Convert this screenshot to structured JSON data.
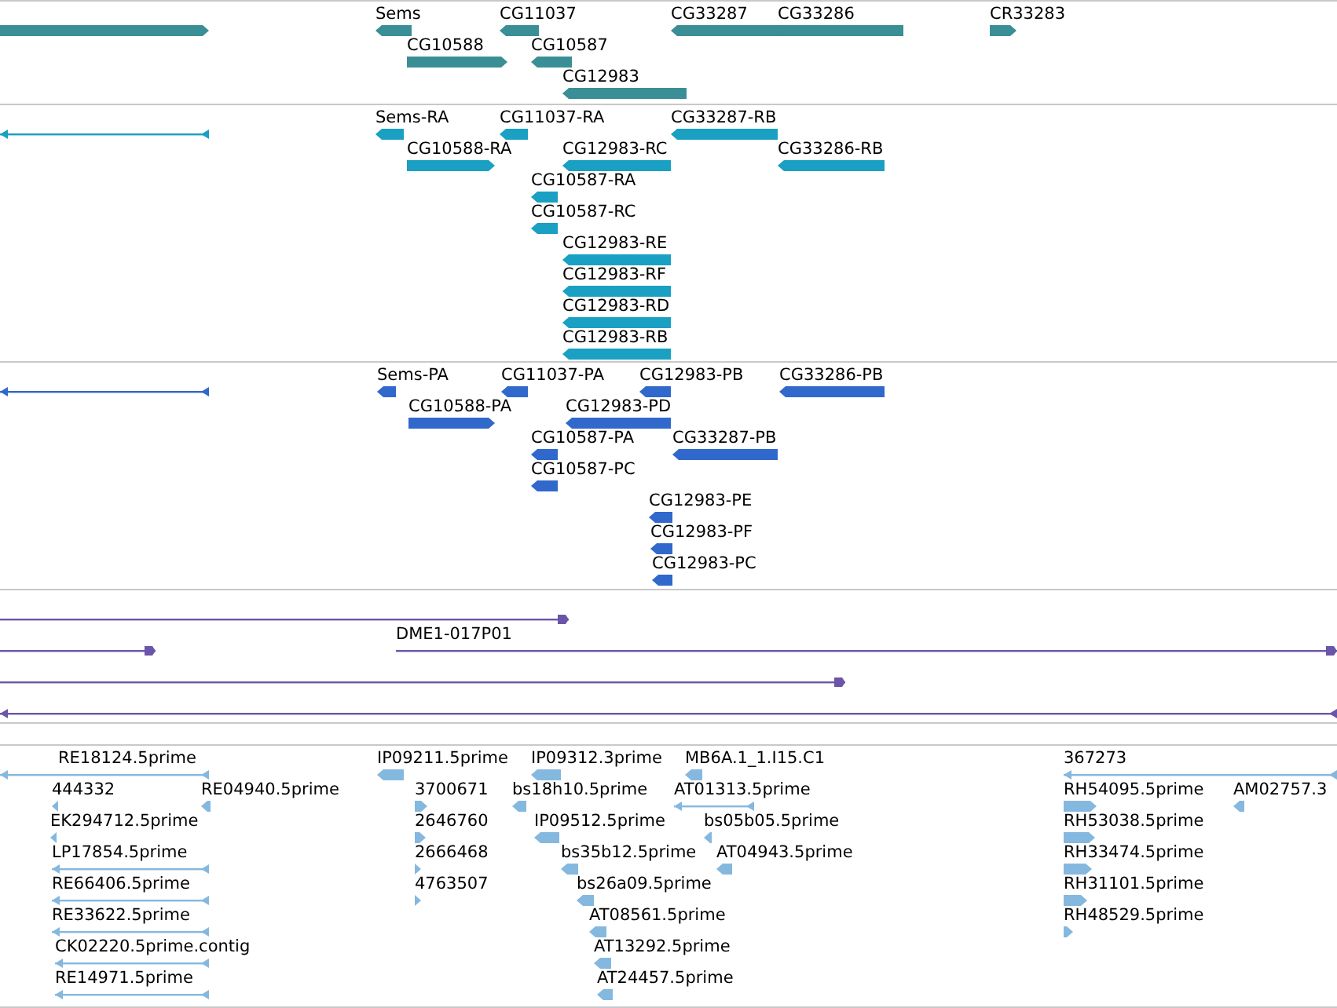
{
  "tracks": [
    {
      "color": "#3a8f96",
      "features": [
        {
          "kind": "block",
          "reverse": false
        },
        {
          "kind": "block",
          "reverse": true,
          "label": "Sems"
        },
        {
          "kind": "block",
          "reverse": true,
          "label": "CG11037"
        },
        {
          "kind": "block",
          "reverse": true,
          "label": "CG33287"
        },
        {
          "kind": "block",
          "reverse": true,
          "label": "CG33286"
        },
        {
          "kind": "block",
          "reverse": false,
          "label": "CR33283"
        },
        {
          "kind": "block",
          "reverse": false,
          "label": "CG10588"
        },
        {
          "kind": "block",
          "reverse": true,
          "label": "CG10587"
        },
        {
          "kind": "block",
          "reverse": true,
          "label": "CG12983"
        }
      ]
    },
    {
      "color": "#1aa0c2",
      "features": [
        {
          "kind": "line",
          "reverse": true
        },
        {
          "kind": "block",
          "reverse": true,
          "label": "Sems-RA"
        },
        {
          "kind": "block",
          "reverse": true,
          "label": "CG11037-RA"
        },
        {
          "kind": "block",
          "reverse": true,
          "label": "CG33287-RB"
        },
        {
          "kind": "block",
          "reverse": false,
          "label": "CG10588-RA"
        },
        {
          "kind": "block",
          "reverse": true,
          "label": "CG12983-RC"
        },
        {
          "kind": "block",
          "reverse": true,
          "label": "CG33286-RB"
        },
        {
          "kind": "block",
          "reverse": true,
          "label": "CG10587-RA"
        },
        {
          "kind": "block",
          "reverse": true,
          "label": "CG10587-RC"
        },
        {
          "kind": "block",
          "reverse": true,
          "label": "CG12983-RE"
        },
        {
          "kind": "block",
          "reverse": true,
          "label": "CG12983-RF"
        },
        {
          "kind": "block",
          "reverse": true,
          "label": "CG12983-RD"
        },
        {
          "kind": "block",
          "reverse": true,
          "label": "CG12983-RB"
        }
      ]
    },
    {
      "color": "#3068cc",
      "features": [
        {
          "kind": "line",
          "reverse": true
        },
        {
          "kind": "block",
          "reverse": true,
          "label": "Sems-PA"
        },
        {
          "kind": "block",
          "reverse": true,
          "label": "CG11037-PA"
        },
        {
          "kind": "block",
          "reverse": true,
          "label": "CG12983-PB"
        },
        {
          "kind": "block",
          "reverse": true,
          "label": "CG33286-PB"
        },
        {
          "kind": "block",
          "reverse": false,
          "label": "CG10588-PA"
        },
        {
          "kind": "block",
          "reverse": true,
          "label": "CG12983-PD"
        },
        {
          "kind": "block",
          "reverse": true,
          "label": "CG10587-PA"
        },
        {
          "kind": "block",
          "reverse": true,
          "label": "CG33287-PB"
        },
        {
          "kind": "block",
          "reverse": true,
          "label": "CG10587-PC"
        },
        {
          "kind": "block",
          "reverse": true,
          "label": "CG12983-PE"
        },
        {
          "kind": "block",
          "reverse": true,
          "label": "CG12983-PF"
        },
        {
          "kind": "block",
          "reverse": true,
          "label": "CG12983-PC"
        }
      ]
    },
    {
      "color": "#6b55a8",
      "features": [
        {
          "kind": "line",
          "reverse": false
        },
        {
          "kind": "line",
          "reverse": false
        },
        {
          "kind": "line",
          "reverse": false,
          "label": "DME1-017P01"
        },
        {
          "kind": "line",
          "reverse": false
        },
        {
          "kind": "line",
          "reverse": true
        }
      ]
    },
    {
      "color": "#85b8df",
      "features": [
        {
          "kind": "line",
          "reverse": true,
          "label": "RE18124.5prime"
        },
        {
          "kind": "block",
          "reverse": true,
          "label": "IP09211.5prime"
        },
        {
          "kind": "block",
          "reverse": true,
          "label": "IP09312.3prime"
        },
        {
          "kind": "block",
          "reverse": true,
          "label": "MB6A.1_1.I15.C1"
        },
        {
          "kind": "line",
          "reverse": true,
          "label": "367273"
        },
        {
          "kind": "block",
          "reverse": true,
          "label": "444332"
        },
        {
          "kind": "block",
          "reverse": true,
          "label": "RE04940.5prime"
        },
        {
          "kind": "block",
          "reverse": false,
          "label": "3700671"
        },
        {
          "kind": "block",
          "reverse": true,
          "label": "bs18h10.5prime"
        },
        {
          "kind": "line",
          "reverse": true,
          "label": "AT01313.5prime"
        },
        {
          "kind": "block",
          "reverse": false,
          "label": "RH54095.5prime"
        },
        {
          "kind": "block",
          "reverse": true,
          "label": "AM02757.3"
        },
        {
          "kind": "block",
          "reverse": true,
          "label": "EK294712.5prime"
        },
        {
          "kind": "block",
          "reverse": false,
          "label": "2646760"
        },
        {
          "kind": "block",
          "reverse": true,
          "label": "IP09512.5prime"
        },
        {
          "kind": "block",
          "reverse": true,
          "label": "bs05b05.5prime"
        },
        {
          "kind": "block",
          "reverse": false,
          "label": "RH53038.5prime"
        },
        {
          "kind": "line",
          "reverse": true,
          "label": "LP17854.5prime"
        },
        {
          "kind": "block",
          "reverse": false,
          "label": "2666468"
        },
        {
          "kind": "block",
          "reverse": true,
          "label": "bs35b12.5prime"
        },
        {
          "kind": "block",
          "reverse": true,
          "label": "AT04943.5prime"
        },
        {
          "kind": "block",
          "reverse": false,
          "label": "RH33474.5prime"
        },
        {
          "kind": "line",
          "reverse": true,
          "label": "RE66406.5prime"
        },
        {
          "kind": "block",
          "reverse": false,
          "label": "4763507"
        },
        {
          "kind": "block",
          "reverse": true,
          "label": "bs26a09.5prime"
        },
        {
          "kind": "block",
          "reverse": false,
          "label": "RH31101.5prime"
        },
        {
          "kind": "line",
          "reverse": true,
          "label": "RE33622.5prime"
        },
        {
          "kind": "block",
          "reverse": true,
          "label": "AT08561.5prime"
        },
        {
          "kind": "block",
          "reverse": false,
          "label": "RH48529.5prime"
        },
        {
          "kind": "line",
          "reverse": true,
          "label": "CK02220.5prime.contig"
        },
        {
          "kind": "block",
          "reverse": true,
          "label": "AT13292.5prime"
        },
        {
          "kind": "line",
          "reverse": true,
          "label": "RE14971.5prime"
        },
        {
          "kind": "block",
          "reverse": true,
          "label": "AT24457.5prime"
        }
      ]
    }
  ]
}
